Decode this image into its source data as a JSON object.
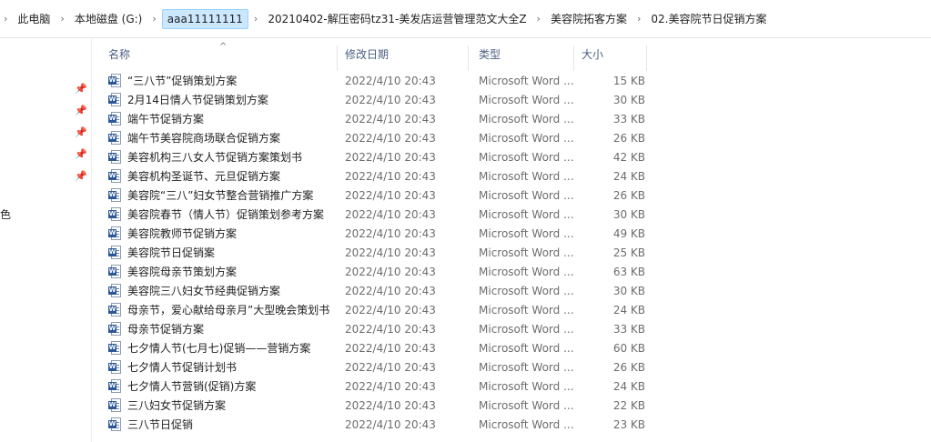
{
  "breadcrumb": [
    "此电脑",
    "本地磁盘 (G:)",
    "aaa11111111",
    "20210402-解压密码tz31-美发店运营管理范文大全Z",
    "美容院拓客方案",
    "02.美容院节日促销方案"
  ],
  "nav": {
    "partial_label": "色"
  },
  "columns": {
    "name": "名称",
    "date": "修改日期",
    "type": "类型",
    "size": "大小"
  },
  "files": [
    {
      "name": "“三八节”促销策划方案",
      "date": "2022/4/10 20:43",
      "type": "Microsoft Word ...",
      "size": "15 KB"
    },
    {
      "name": "2月14日情人节促销策划方案",
      "date": "2022/4/10 20:43",
      "type": "Microsoft Word ...",
      "size": "30 KB"
    },
    {
      "name": "端午节促销方案",
      "date": "2022/4/10 20:43",
      "type": "Microsoft Word ...",
      "size": "33 KB"
    },
    {
      "name": "端午节美容院商场联合促销方案",
      "date": "2022/4/10 20:43",
      "type": "Microsoft Word ...",
      "size": "26 KB"
    },
    {
      "name": "美容机构三八女人节促销方案策划书",
      "date": "2022/4/10 20:43",
      "type": "Microsoft Word ...",
      "size": "42 KB"
    },
    {
      "name": "美容机构圣诞节、元旦促销方案",
      "date": "2022/4/10 20:43",
      "type": "Microsoft Word ...",
      "size": "24 KB"
    },
    {
      "name": "美容院“三八”妇女节整合营销推广方案",
      "date": "2022/4/10 20:43",
      "type": "Microsoft Word ...",
      "size": "26 KB"
    },
    {
      "name": "美容院春节（情人节）促销策划参考方案",
      "date": "2022/4/10 20:43",
      "type": "Microsoft Word ...",
      "size": "30 KB"
    },
    {
      "name": "美容院教师节促销方案",
      "date": "2022/4/10 20:43",
      "type": "Microsoft Word ...",
      "size": "49 KB"
    },
    {
      "name": "美容院节日促销案",
      "date": "2022/4/10 20:43",
      "type": "Microsoft Word ...",
      "size": "25 KB"
    },
    {
      "name": "美容院母亲节策划方案",
      "date": "2022/4/10 20:43",
      "type": "Microsoft Word ...",
      "size": "63 KB"
    },
    {
      "name": "美容院三八妇女节经典促销方案",
      "date": "2022/4/10 20:43",
      "type": "Microsoft Word ...",
      "size": "30 KB"
    },
    {
      "name": "母亲节，爱心献给母亲月”大型晚会策划书",
      "date": "2022/4/10 20:43",
      "type": "Microsoft Word ...",
      "size": "24 KB"
    },
    {
      "name": "母亲节促销方案",
      "date": "2022/4/10 20:43",
      "type": "Microsoft Word ...",
      "size": "33 KB"
    },
    {
      "name": "七夕情人节(七月七)促销——营销方案",
      "date": "2022/4/10 20:43",
      "type": "Microsoft Word ...",
      "size": "60 KB"
    },
    {
      "name": "七夕情人节促销计划书",
      "date": "2022/4/10 20:43",
      "type": "Microsoft Word ...",
      "size": "26 KB"
    },
    {
      "name": "七夕情人节营销(促销)方案",
      "date": "2022/4/10 20:43",
      "type": "Microsoft Word ...",
      "size": "24 KB"
    },
    {
      "name": "三八妇女节促销方案",
      "date": "2022/4/10 20:43",
      "type": "Microsoft Word ...",
      "size": "22 KB"
    },
    {
      "name": "三八节日促销",
      "date": "2022/4/10 20:43",
      "type": "Microsoft Word ...",
      "size": "23 KB"
    }
  ],
  "icons": {
    "file": "word-document-icon",
    "pin": "pin-icon",
    "sort": "sort-ascending-icon",
    "chevron": "chevron-right-icon"
  },
  "colors": {
    "selected_crumb": "#cce8ff",
    "header_text": "#4d6082",
    "word_blue": "#2b5797"
  }
}
